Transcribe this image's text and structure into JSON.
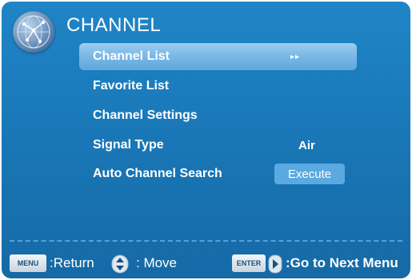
{
  "header": {
    "title": "CHANNEL",
    "logo_icon": "globe-icon"
  },
  "menu": {
    "items": [
      {
        "label": "Channel List",
        "value": "▸▸",
        "selected": true
      },
      {
        "label": "Favorite List",
        "value": ""
      },
      {
        "label": "Channel Settings",
        "value": ""
      },
      {
        "label": "Signal Type",
        "value": "Air"
      },
      {
        "label": "Auto Channel Search",
        "button": "Execute"
      }
    ]
  },
  "footer": {
    "menu_key": "MENU",
    "return_label": ":Return",
    "move_label": ": Move",
    "enter_key": "ENTER",
    "next_label": ":Go to Next Menu"
  },
  "colors": {
    "background": "#1a78b8",
    "highlight": "#78b7e6",
    "button": "#5aa9e0"
  }
}
